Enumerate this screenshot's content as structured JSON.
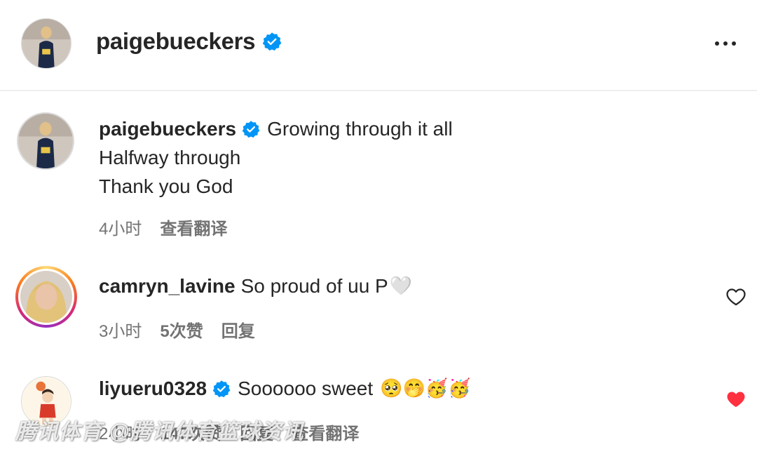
{
  "header": {
    "username": "paigebueckers",
    "verified": true,
    "more_icon": "more-horizontal-icon"
  },
  "post": {
    "username": "paigebueckers",
    "verified": true,
    "caption_line1": "Growing through it all",
    "caption_line2": "Halfway through",
    "caption_line3": "Thank you God",
    "time": "4小时",
    "translate": "查看翻译"
  },
  "comments": [
    {
      "username": "camryn_lavine",
      "text": "So proud of uu P",
      "emoji": "🤍",
      "time": "3小时",
      "likes": "5次赞",
      "reply": "回复",
      "liked": false
    },
    {
      "username": "liyueru0328",
      "verified": true,
      "text": "Soooooo sweet",
      "emoji": "🥺🤭🥳🥳",
      "time": "2小时",
      "likes": "147次赞",
      "reply": "回复",
      "translate": "查看翻译",
      "liked": true
    }
  ],
  "watermark": "腾讯体育 @腾讯体育篮球资讯",
  "colors": {
    "text": "#262626",
    "secondary": "#737373",
    "verified": "#0095f6",
    "heart_liked": "#ff3040",
    "divider": "#efefef"
  }
}
